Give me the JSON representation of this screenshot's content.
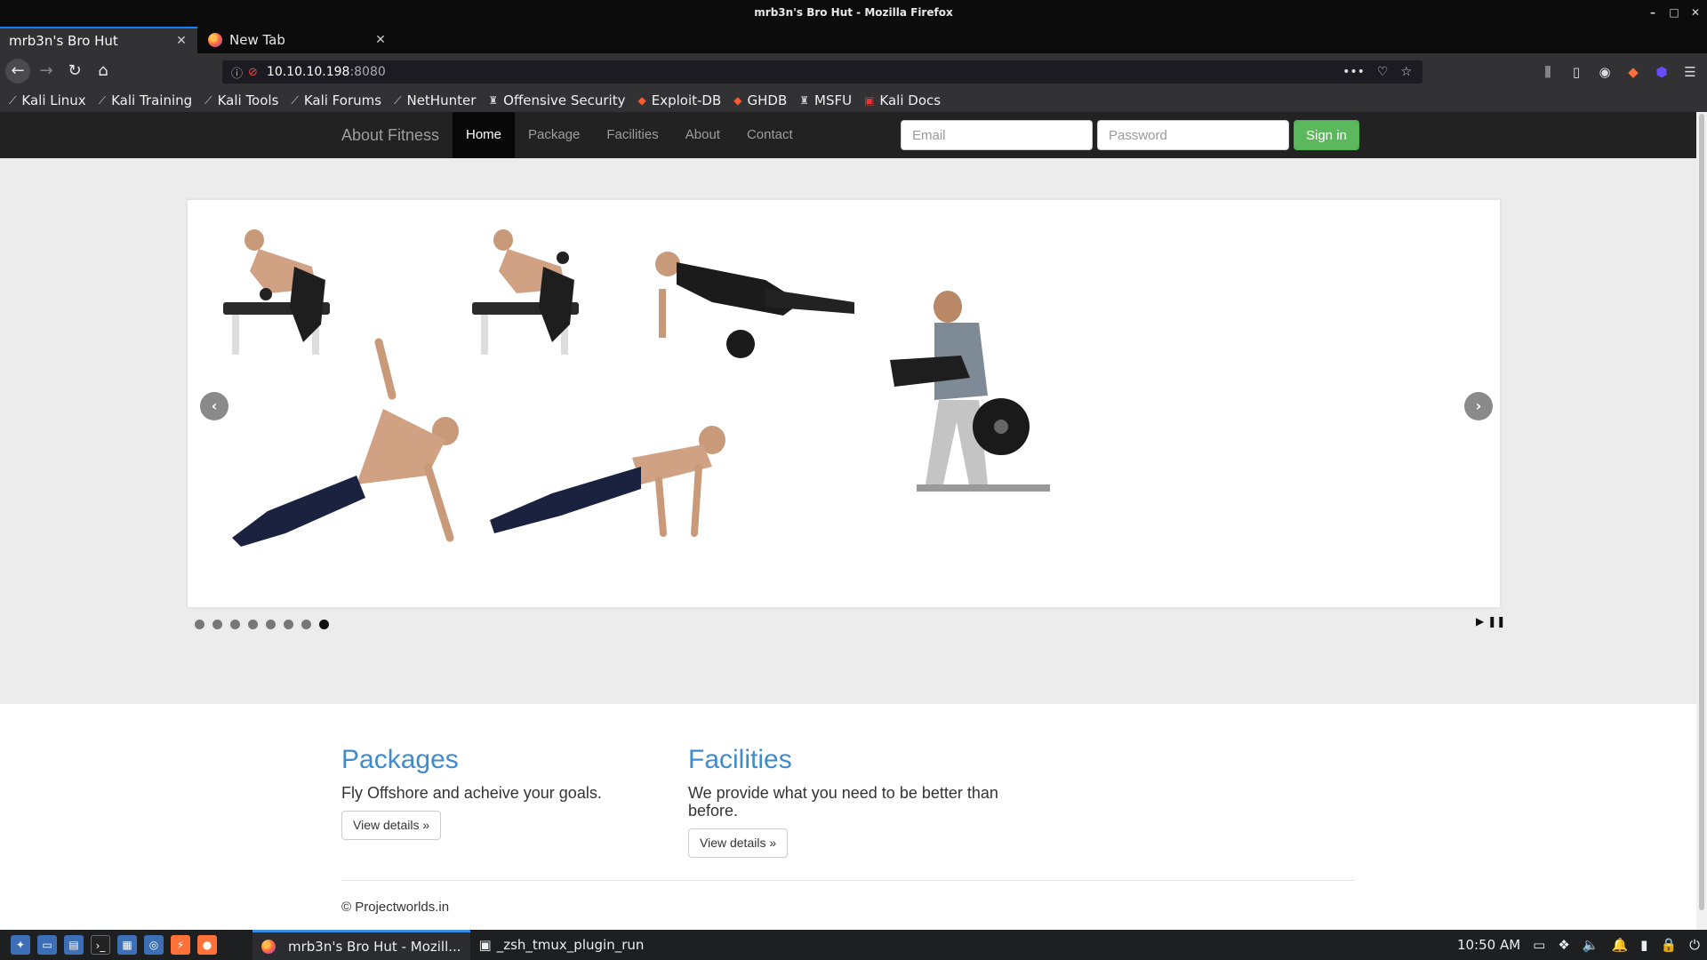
{
  "window": {
    "title": "mrb3n's Bro Hut - Mozilla Firefox",
    "controls": [
      "–",
      "□",
      "✕"
    ]
  },
  "tabs": [
    {
      "label": "mrb3n's Bro Hut",
      "active": true
    },
    {
      "label": "New Tab",
      "active": false
    }
  ],
  "urlbar": {
    "host": "10.10.10.198",
    "port": ":8080"
  },
  "bookmarks": [
    {
      "label": "Kali Linux",
      "icon": "kali-dragon-icon"
    },
    {
      "label": "Kali Training",
      "icon": "kali-dragon-icon"
    },
    {
      "label": "Kali Tools",
      "icon": "kali-dragon-icon"
    },
    {
      "label": "Kali Forums",
      "icon": "kali-dragon-icon"
    },
    {
      "label": "NetHunter",
      "icon": "kali-dragon-icon"
    },
    {
      "label": "Offensive Security",
      "icon": "offsec-icon"
    },
    {
      "label": "Exploit-DB",
      "icon": "exploitdb-icon"
    },
    {
      "label": "GHDB",
      "icon": "exploitdb-icon"
    },
    {
      "label": "MSFU",
      "icon": "offsec-icon"
    },
    {
      "label": "Kali Docs",
      "icon": "kali-docs-icon"
    }
  ],
  "site": {
    "brand": "About Fitness",
    "nav": [
      "Home",
      "Package",
      "Facilities",
      "About",
      "Contact"
    ],
    "active_nav": "Home",
    "email_placeholder": "Email",
    "password_placeholder": "Password",
    "signin_label": "Sign in",
    "carousel": {
      "slide_count": 8,
      "active_slide": 8,
      "prev": "‹",
      "next": "›"
    },
    "sections": [
      {
        "heading": "Packages",
        "text": "Fly Offshore and acheive your goals.",
        "button": "View details »"
      },
      {
        "heading": "Facilities",
        "text": "We provide what you need to be better than before.",
        "button": "View details »"
      }
    ],
    "footer": "© Projectworlds.in"
  },
  "taskbar": {
    "windows": [
      {
        "label": "mrb3n's Bro Hut - Mozill...",
        "active": true
      },
      {
        "label": "_zsh_tmux_plugin_run",
        "active": false
      }
    ],
    "clock": "10:50 AM"
  },
  "colors": {
    "nav_active_bg": "#080808",
    "signin_green": "#5cb85c",
    "heading_blue": "#428bca",
    "tab_accent": "#0a84ff"
  }
}
